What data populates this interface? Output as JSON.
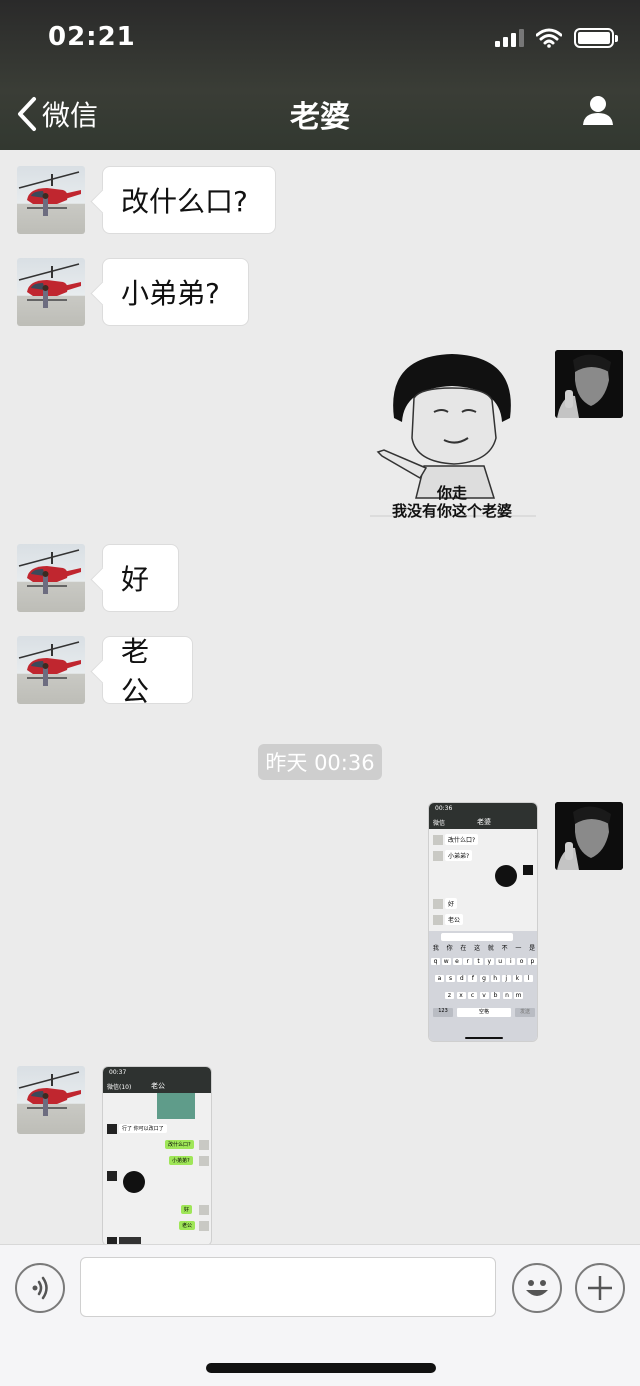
{
  "status_bar": {
    "time": "02:21"
  },
  "nav": {
    "back_label": "微信",
    "title": "老婆"
  },
  "messages": [
    {
      "text": "改什么口?"
    },
    {
      "text": "小弟弟?"
    },
    {
      "text": "好"
    },
    {
      "text": "老公"
    }
  ],
  "sticker": {
    "line1": "你走",
    "line2": "我没有你这个老婆"
  },
  "timestamp": "昨天 00:36",
  "screenshot1": {
    "time": "00:36",
    "back": "微信",
    "title": "老婆",
    "msgs": [
      "改什么口?",
      "小弟弟?",
      "好",
      "老公"
    ],
    "suggestions": [
      "我",
      "你",
      "在",
      "这",
      "就",
      "不",
      "一",
      "是"
    ],
    "row1": [
      "q",
      "w",
      "e",
      "r",
      "t",
      "y",
      "u",
      "i",
      "o",
      "p"
    ],
    "row2": [
      "a",
      "s",
      "d",
      "f",
      "g",
      "h",
      "j",
      "k",
      "l"
    ],
    "row3": [
      "z",
      "x",
      "c",
      "v",
      "b",
      "n",
      "m"
    ],
    "num_key": "123",
    "space_key": "空格",
    "send_key": "发送"
  },
  "screenshot2": {
    "time": "00:37",
    "back": "微信(10)",
    "title": "老公",
    "msg1": "行了 你可以改口了",
    "msg2": "改什么口?",
    "msg3": "小弟弟?",
    "msg4": "好",
    "msg5": "老公"
  }
}
